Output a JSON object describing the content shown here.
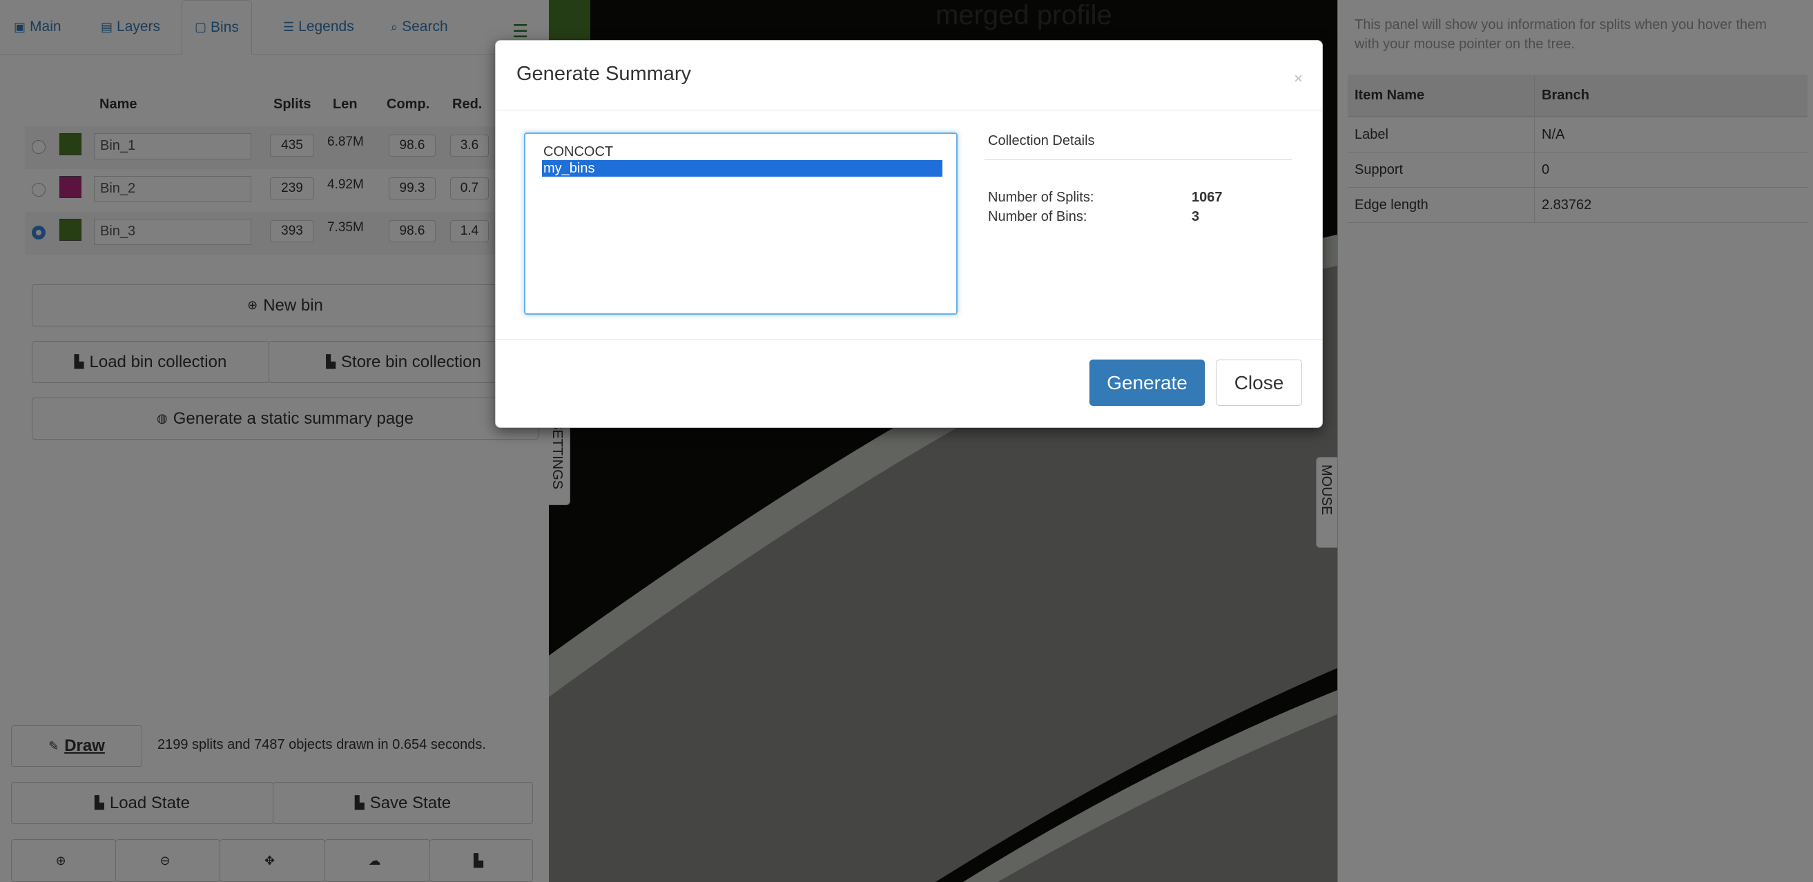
{
  "tabs": [
    {
      "label": "Main",
      "icon": "image-icon"
    },
    {
      "label": "Layers",
      "icon": "briefcase-icon"
    },
    {
      "label": "Bins",
      "icon": "inbox-icon"
    },
    {
      "label": "Legends",
      "icon": "list-alt-icon"
    },
    {
      "label": "Search",
      "icon": "search-icon"
    }
  ],
  "bins_table": {
    "headers": {
      "name": "Name",
      "splits": "Splits",
      "len": "Len",
      "comp": "Comp.",
      "red": "Red."
    },
    "rows": [
      {
        "name": "Bin_1",
        "color": "#4f7a28",
        "splits": "435",
        "len": "6.87M",
        "comp": "98.6",
        "red": "3.6",
        "selected": false
      },
      {
        "name": "Bin_2",
        "color": "#b4287f",
        "splits": "239",
        "len": "4.92M",
        "comp": "99.3",
        "red": "0.7",
        "selected": false
      },
      {
        "name": "Bin_3",
        "color": "#4f7a28",
        "splits": "393",
        "len": "7.35M",
        "comp": "98.6",
        "red": "1.4",
        "selected": true
      }
    ]
  },
  "buttons": {
    "new_bin": "New bin",
    "load_bin_collection": "Load bin collection",
    "store_bin_collection": "Store bin collection",
    "generate_static_summary": "Generate a static summary page",
    "draw": "Draw",
    "load_state": "Load State",
    "save_state": "Save State"
  },
  "status_text": "2199 splits and 7487 objects drawn in 0.654 seconds.",
  "center": {
    "title": "merged profile",
    "settings_tab": "SETTINGS",
    "mouse_tab": "MOUSE"
  },
  "right_panel": {
    "note": "This panel will show you information for splits when you hover them with your mouse pointer on the tree.",
    "headers": [
      "Item Name",
      "Branch"
    ],
    "rows": [
      [
        "Label",
        "N/A"
      ],
      [
        "Support",
        "0"
      ],
      [
        "Edge length",
        "2.83762"
      ]
    ]
  },
  "modal": {
    "title": "Generate Summary",
    "close_x": "×",
    "collections": [
      "CONCOCT",
      "my_bins"
    ],
    "selected_collection": "my_bins",
    "details_heading": "Collection Details",
    "details": [
      {
        "label": "Number of Splits:",
        "value": "1067"
      },
      {
        "label": "Number of Bins:",
        "value": "3"
      }
    ],
    "generate_label": "Generate",
    "close_label": "Close"
  },
  "colors": {
    "accent": "#337ab7",
    "selection": "#1e6fd9",
    "tree_dark": "#0d0f0b",
    "tree_band": "#c2c6be",
    "canvas_gray": "#8b8d87"
  }
}
